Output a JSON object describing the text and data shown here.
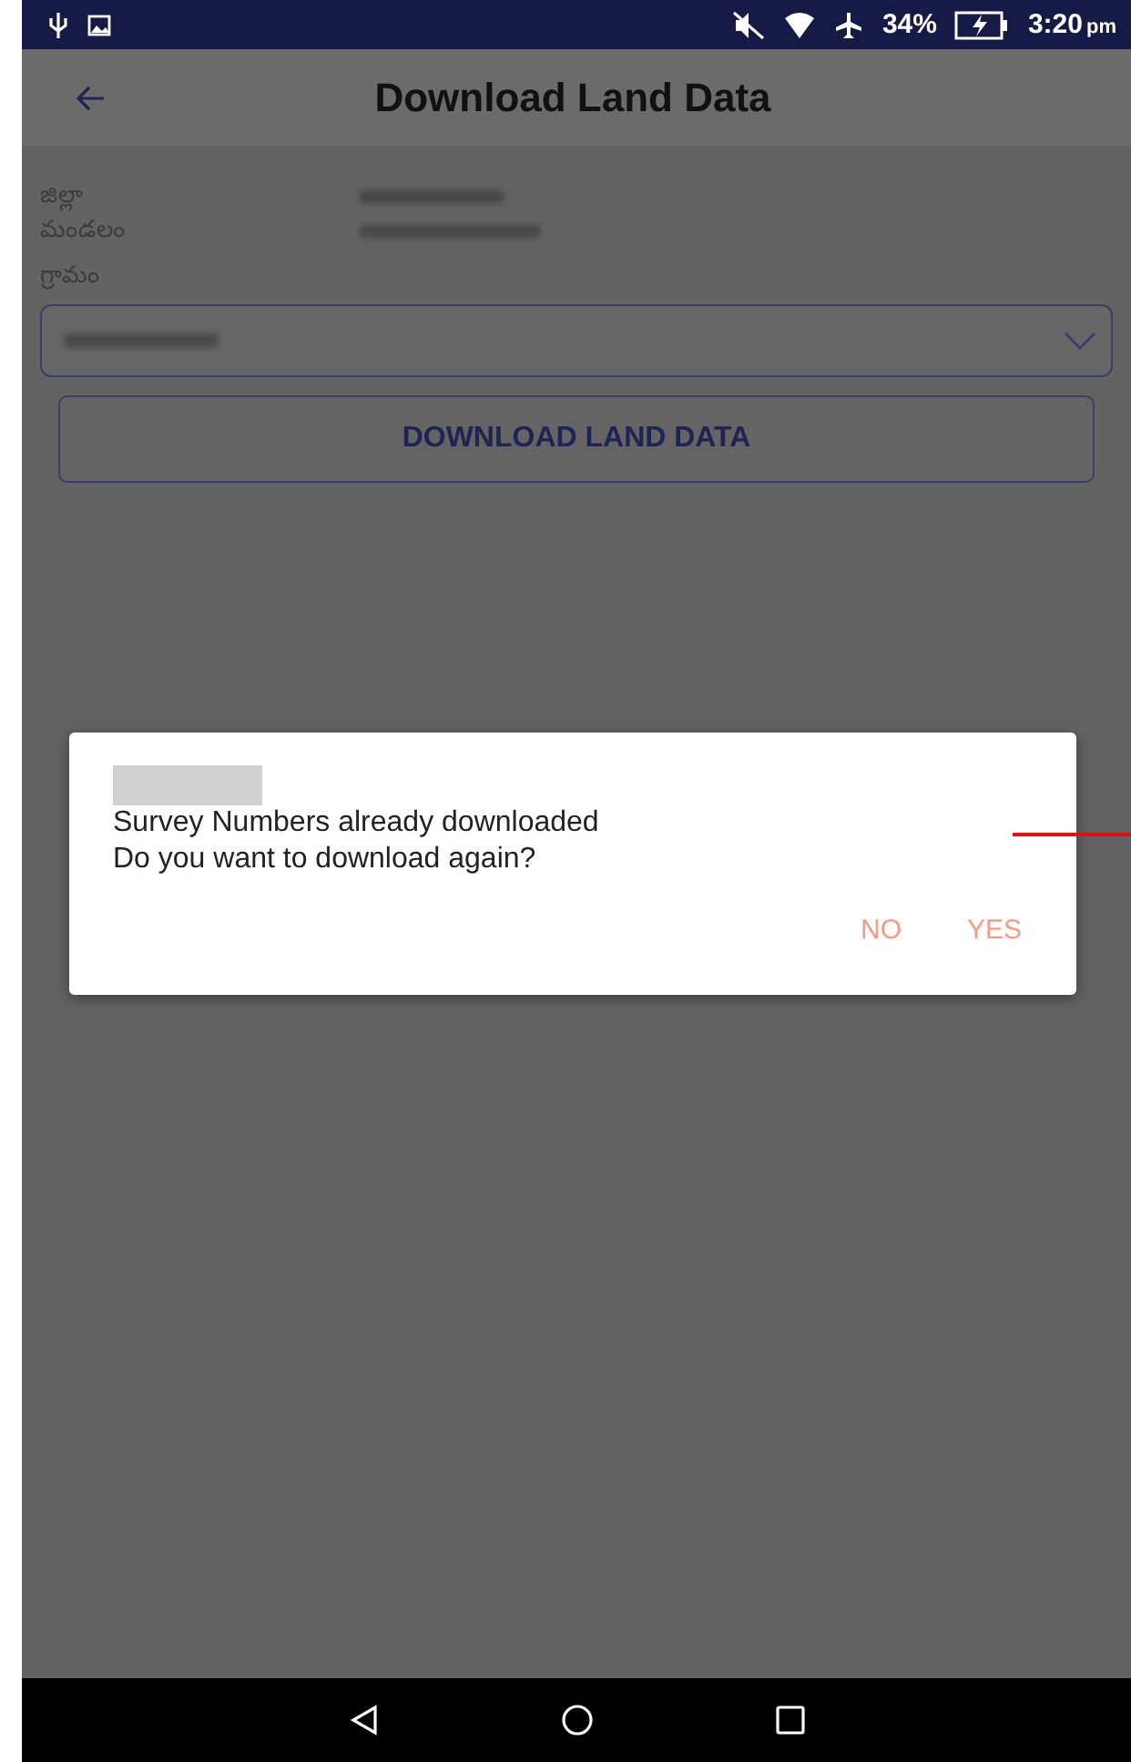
{
  "status_bar": {
    "battery": "34%",
    "time": "3:20",
    "time_suffix": "pm"
  },
  "header": {
    "title": "Download Land Data"
  },
  "details": [
    {
      "label": "జిల్లా"
    },
    {
      "label": "మండలం"
    }
  ],
  "village": {
    "label": "గ్రామం"
  },
  "download_button": "DOWNLOAD LAND DATA",
  "dialog": {
    "lines": [
      "Survey Numbers already downloaded",
      "Do you want to download again?"
    ],
    "buttons": [
      "NO",
      "YES"
    ]
  }
}
